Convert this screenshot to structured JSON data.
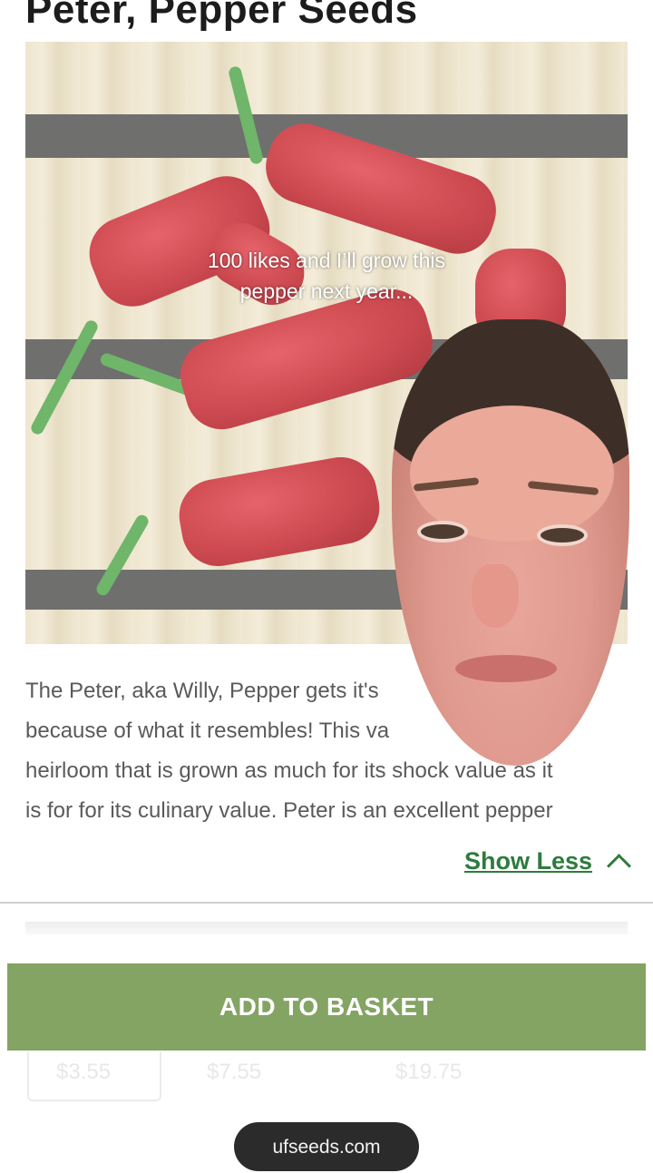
{
  "product": {
    "title": "Peter, Pepper Seeds",
    "description_lines": [
      "The Peter, aka Willy, Pepper gets it's",
      "because of what it resembles! This va",
      "heirloom that is grown as much for its shock value as it",
      "is for for its culinary value. Peter is an excellent pepper"
    ],
    "show_less_label": "Show Less"
  },
  "overlay": {
    "caption_line1": "100 likes and I’ll grow this",
    "caption_line2": "pepper next year..."
  },
  "purchase": {
    "add_to_basket_label": "ADD TO BASKET",
    "prices": [
      "$3.55",
      "$7.55",
      "$19.75"
    ]
  },
  "footer": {
    "domain": "ufseeds.com"
  },
  "colors": {
    "accent_green": "#2e7b3e",
    "button_green": "#84a463"
  },
  "icons": {
    "show_less": "chevron-up-icon"
  }
}
